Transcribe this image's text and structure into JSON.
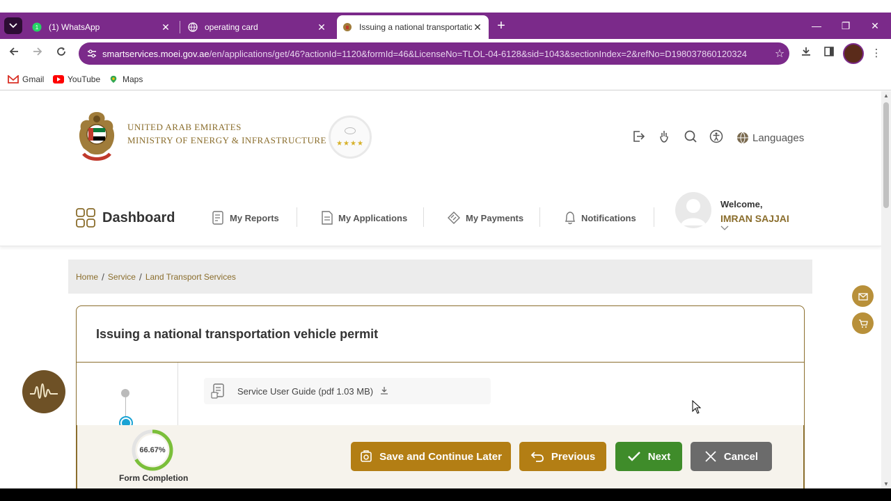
{
  "browser": {
    "tabs": [
      {
        "title": "(1) WhatsApp",
        "icon": "whatsapp-icon",
        "active": false
      },
      {
        "title": "operating card",
        "icon": "globe-icon",
        "active": false
      },
      {
        "title": "Issuing a national transportatio",
        "icon": "uae-emblem-icon",
        "active": true
      }
    ],
    "url_host": "smartservices.moei.gov.ae",
    "url_path": "/en/applications/get/46?actionId=1120&formId=46&LicenseNo=TLOL-04-6128&sid=1043&sectionIndex=2&refNo=D198037860120324",
    "bookmarks": [
      {
        "label": "Gmail",
        "icon": "gmail-icon"
      },
      {
        "label": "YouTube",
        "icon": "youtube-icon"
      },
      {
        "label": "Maps",
        "icon": "maps-icon"
      }
    ],
    "colors": {
      "theme": "#7b2a8a"
    }
  },
  "header": {
    "ministry_line1": "UNITED ARAB EMIRATES",
    "ministry_line2": "MINISTRY OF ENERGY & INFRASTRUCTURE",
    "seal_stars": "★★★★",
    "languages_label": "Languages"
  },
  "nav": {
    "dashboard_label": "Dashboard",
    "items": [
      {
        "label": "My Reports",
        "icon": "reports-icon"
      },
      {
        "label": "My Applications",
        "icon": "applications-icon"
      },
      {
        "label": "My Payments",
        "icon": "payments-icon"
      },
      {
        "label": "Notifications",
        "icon": "bell-icon"
      }
    ],
    "welcome_label": "Welcome,",
    "user_name": "IMRAN SAJJAI"
  },
  "breadcrumb": {
    "items": [
      "Home",
      "Service",
      "Land Transport Services"
    ]
  },
  "form": {
    "title": "Issuing a national transportation vehicle permit",
    "guide_label": "Service User Guide (pdf 1.03 MB)",
    "progress_percent_text": "66.67%",
    "progress_fraction": 0.6667,
    "progress_caption": "Form Completion",
    "buttons": {
      "save": "Save and Continue Later",
      "previous": "Previous",
      "next": "Next",
      "cancel": "Cancel"
    }
  },
  "colors": {
    "gold": "#8a6d2c",
    "button_gold": "#b37e14",
    "button_green": "#3f8c2a",
    "button_grey": "#6b6b6b",
    "step_active": "#1aa3d4"
  }
}
